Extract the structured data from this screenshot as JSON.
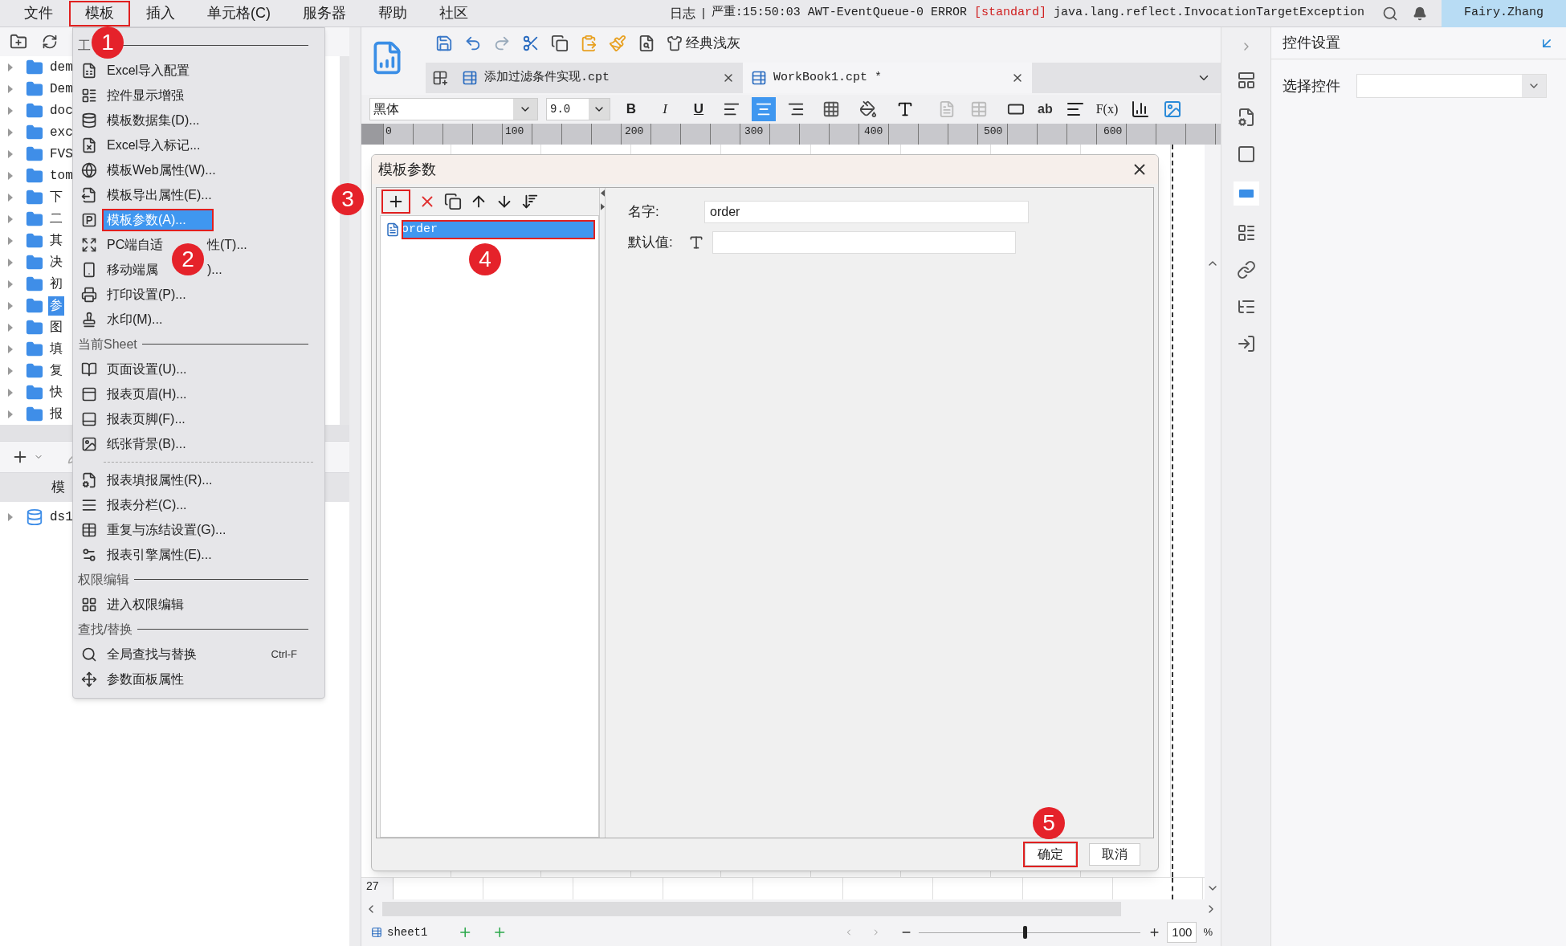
{
  "menu_bar": {
    "items": [
      {
        "label": "文件",
        "highlighted": false
      },
      {
        "label": "模板",
        "highlighted": true
      },
      {
        "label": "插入",
        "highlighted": false
      },
      {
        "label": "单元格(C)",
        "highlighted": false
      },
      {
        "label": "服务器",
        "highlighted": false
      },
      {
        "label": "帮助",
        "highlighted": false
      },
      {
        "label": "社区",
        "highlighted": false
      }
    ],
    "log": {
      "label": "日志",
      "separator": "|",
      "prefix": "严重:15:50:03 AWT-EventQueue-0 ERROR ",
      "tag": "[standard]",
      "message": " java.lang.reflect.InvocationTargetException"
    },
    "user": "Fairy.Zhang"
  },
  "sidebar": {
    "tree": [
      {
        "label": "dem",
        "selected": false
      },
      {
        "label": "Dem",
        "selected": false
      },
      {
        "label": "doc",
        "selected": false
      },
      {
        "label": "exc",
        "selected": false
      },
      {
        "label": "FVS",
        "selected": false
      },
      {
        "label": "tom",
        "selected": false
      },
      {
        "label": "下",
        "selected": false
      },
      {
        "label": "二",
        "selected": false
      },
      {
        "label": "其",
        "selected": false
      },
      {
        "label": "决",
        "selected": false
      },
      {
        "label": "初",
        "selected": false
      },
      {
        "label": "参",
        "selected": true
      },
      {
        "label": "图",
        "selected": false
      },
      {
        "label": "填",
        "selected": false
      },
      {
        "label": "复",
        "selected": false
      },
      {
        "label": "快",
        "selected": false
      },
      {
        "label": "报",
        "selected": false
      }
    ],
    "bottom_header": "模",
    "datasets": [
      {
        "label": "ds1"
      }
    ]
  },
  "menu": {
    "entries": [
      {
        "kind": "header",
        "label": "工"
      },
      {
        "kind": "item",
        "label": "Excel导入配置",
        "highlighted": false
      },
      {
        "kind": "item",
        "label": "控件显示增强",
        "highlighted": false
      },
      {
        "kind": "item",
        "label": "模板数据集(D)...",
        "highlighted": false
      },
      {
        "kind": "item",
        "label": "Excel导入标记...",
        "highlighted": false
      },
      {
        "kind": "item",
        "label": "模板Web属性(W)...",
        "highlighted": false
      },
      {
        "kind": "item",
        "label": "模板导出属性(E)...",
        "highlighted": false
      },
      {
        "kind": "item",
        "label": "模板参数(A)...",
        "highlighted": true
      },
      {
        "kind": "item",
        "label": "PC端自适",
        "suffix": "性(T)...",
        "highlighted": false
      },
      {
        "kind": "item",
        "label": "移动端属",
        "suffix": ")...",
        "highlighted": false
      },
      {
        "kind": "item",
        "label": "打印设置(P)...",
        "highlighted": false
      },
      {
        "kind": "item",
        "label": "水印(M)...",
        "highlighted": false
      },
      {
        "kind": "header",
        "label": "当前Sheet"
      },
      {
        "kind": "item",
        "label": "页面设置(U)...",
        "highlighted": false
      },
      {
        "kind": "item",
        "label": "报表页眉(H)...",
        "highlighted": false
      },
      {
        "kind": "item",
        "label": "报表页脚(F)...",
        "highlighted": false
      },
      {
        "kind": "item",
        "label": "纸张背景(B)...",
        "highlighted": false
      },
      {
        "kind": "separator"
      },
      {
        "kind": "item",
        "label": "报表填报属性(R)...",
        "highlighted": false
      },
      {
        "kind": "item",
        "label": "报表分栏(C)...",
        "highlighted": false
      },
      {
        "kind": "item",
        "label": "重复与冻结设置(G)...",
        "highlighted": false
      },
      {
        "kind": "item",
        "label": "报表引擎属性(E)...",
        "highlighted": false
      },
      {
        "kind": "header",
        "label": "权限编辑"
      },
      {
        "kind": "item",
        "label": "进入权限编辑",
        "highlighted": false
      },
      {
        "kind": "header",
        "label": "查找/替换"
      },
      {
        "kind": "item",
        "label": "全局查找与替换",
        "shortcut": "Ctrl-F",
        "highlighted": false
      },
      {
        "kind": "item",
        "label": "参数面板属性",
        "highlighted": false
      }
    ]
  },
  "toolbar": {
    "theme_button": "经典浅灰"
  },
  "tabs": [
    {
      "label": "添加过滤条件实现.cpt",
      "selected": false
    },
    {
      "label": "WorkBook1.cpt *",
      "selected": true
    }
  ],
  "format_bar": {
    "font": "黑体",
    "size": "9.0",
    "style_buttons": [
      {
        "label": "B",
        "kind": "bold"
      },
      {
        "label": "I",
        "kind": "italic"
      },
      {
        "label": "U",
        "kind": "underline"
      }
    ],
    "alignment": [
      {
        "selected": false
      },
      {
        "selected": true
      },
      {
        "selected": false
      }
    ],
    "label_button": "ab",
    "formula_button": "F(x)"
  },
  "ruler": {
    "ticks": [
      "0",
      "100",
      "200",
      "300",
      "400",
      "500",
      "600"
    ]
  },
  "sheet": {
    "row_label": "27"
  },
  "dialog": {
    "title": "模板参数",
    "add_highlighted": true,
    "parameters": [
      {
        "name": "order",
        "selected": true,
        "highlighted": true
      }
    ],
    "name_label": "名字:",
    "name_value": "order",
    "default_label": "默认值:",
    "buttons": [
      {
        "label": "确定",
        "highlighted": true
      },
      {
        "label": "取消",
        "highlighted": false
      }
    ]
  },
  "status_bar": {
    "sheet_tab": "sheet1",
    "level": 0.48,
    "zoom": "100",
    "zoom_unit": "%"
  },
  "right_panel": {
    "title": "控件设置",
    "select_label": "选择控件"
  },
  "annotations": [
    "1",
    "2",
    "3",
    "4",
    "5"
  ]
}
